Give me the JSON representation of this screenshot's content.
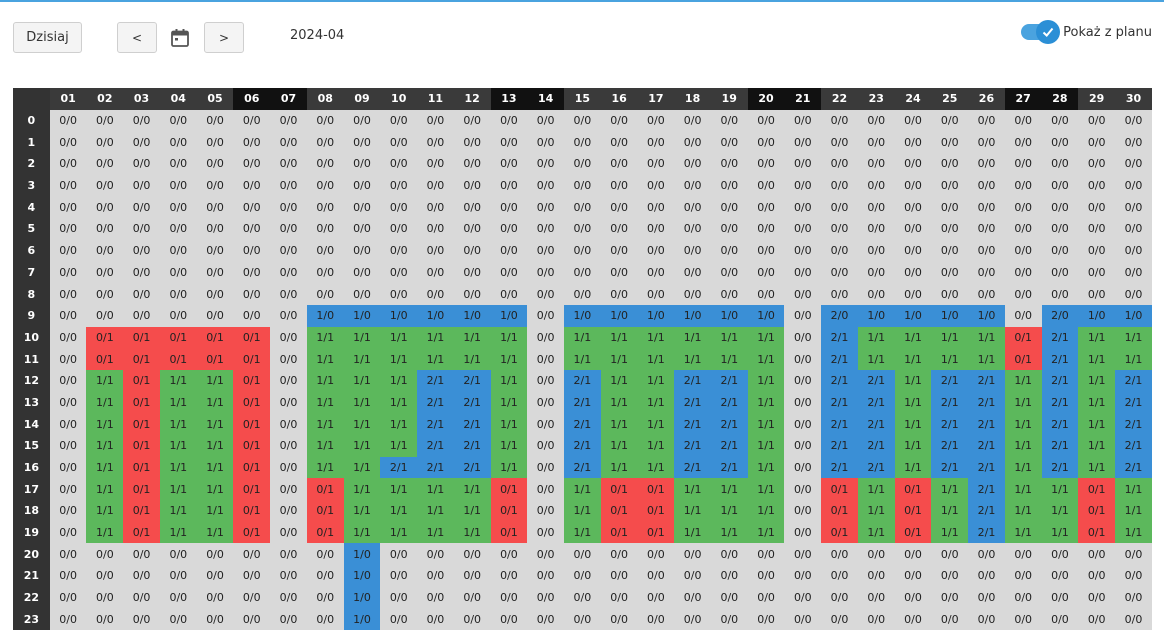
{
  "toolbar": {
    "today_label": "Dzisiaj",
    "prev_label": "<",
    "next_label": ">",
    "calendar_icon": "calendar-icon",
    "period": "2024-04",
    "toggle_label": "Pokaż z planu",
    "toggle_on": true
  },
  "colors": {
    "empty": "#d9d9d9",
    "red": "#f54c4c",
    "green": "#5cb85c",
    "blue": "#3a8fd6",
    "header": "#3a3a3a",
    "weekend_header": "#111111",
    "accent": "#4aa3df"
  },
  "grid": {
    "days": [
      "01",
      "02",
      "03",
      "04",
      "05",
      "06",
      "07",
      "08",
      "09",
      "10",
      "11",
      "12",
      "13",
      "14",
      "15",
      "16",
      "17",
      "18",
      "19",
      "20",
      "21",
      "22",
      "23",
      "24",
      "25",
      "26",
      "27",
      "28",
      "29",
      "30"
    ],
    "weekend_days": [
      "06",
      "07",
      "13",
      "14",
      "20",
      "21",
      "27",
      "28"
    ],
    "hours": [
      "0",
      "1",
      "2",
      "3",
      "4",
      "5",
      "6",
      "7",
      "8",
      "9",
      "10",
      "11",
      "12",
      "13",
      "14",
      "15",
      "16",
      "17",
      "18",
      "19",
      "20",
      "21",
      "22",
      "23"
    ],
    "rows": [
      [
        "0/0",
        "0/0",
        "0/0",
        "0/0",
        "0/0",
        "0/0",
        "0/0",
        "0/0",
        "0/0",
        "0/0",
        "0/0",
        "0/0",
        "0/0",
        "0/0",
        "0/0",
        "0/0",
        "0/0",
        "0/0",
        "0/0",
        "0/0",
        "0/0",
        "0/0",
        "0/0",
        "0/0",
        "0/0",
        "0/0",
        "0/0",
        "0/0",
        "0/0",
        "0/0"
      ],
      [
        "0/0",
        "0/0",
        "0/0",
        "0/0",
        "0/0",
        "0/0",
        "0/0",
        "0/0",
        "0/0",
        "0/0",
        "0/0",
        "0/0",
        "0/0",
        "0/0",
        "0/0",
        "0/0",
        "0/0",
        "0/0",
        "0/0",
        "0/0",
        "0/0",
        "0/0",
        "0/0",
        "0/0",
        "0/0",
        "0/0",
        "0/0",
        "0/0",
        "0/0",
        "0/0"
      ],
      [
        "0/0",
        "0/0",
        "0/0",
        "0/0",
        "0/0",
        "0/0",
        "0/0",
        "0/0",
        "0/0",
        "0/0",
        "0/0",
        "0/0",
        "0/0",
        "0/0",
        "0/0",
        "0/0",
        "0/0",
        "0/0",
        "0/0",
        "0/0",
        "0/0",
        "0/0",
        "0/0",
        "0/0",
        "0/0",
        "0/0",
        "0/0",
        "0/0",
        "0/0",
        "0/0"
      ],
      [
        "0/0",
        "0/0",
        "0/0",
        "0/0",
        "0/0",
        "0/0",
        "0/0",
        "0/0",
        "0/0",
        "0/0",
        "0/0",
        "0/0",
        "0/0",
        "0/0",
        "0/0",
        "0/0",
        "0/0",
        "0/0",
        "0/0",
        "0/0",
        "0/0",
        "0/0",
        "0/0",
        "0/0",
        "0/0",
        "0/0",
        "0/0",
        "0/0",
        "0/0",
        "0/0"
      ],
      [
        "0/0",
        "0/0",
        "0/0",
        "0/0",
        "0/0",
        "0/0",
        "0/0",
        "0/0",
        "0/0",
        "0/0",
        "0/0",
        "0/0",
        "0/0",
        "0/0",
        "0/0",
        "0/0",
        "0/0",
        "0/0",
        "0/0",
        "0/0",
        "0/0",
        "0/0",
        "0/0",
        "0/0",
        "0/0",
        "0/0",
        "0/0",
        "0/0",
        "0/0",
        "0/0"
      ],
      [
        "0/0",
        "0/0",
        "0/0",
        "0/0",
        "0/0",
        "0/0",
        "0/0",
        "0/0",
        "0/0",
        "0/0",
        "0/0",
        "0/0",
        "0/0",
        "0/0",
        "0/0",
        "0/0",
        "0/0",
        "0/0",
        "0/0",
        "0/0",
        "0/0",
        "0/0",
        "0/0",
        "0/0",
        "0/0",
        "0/0",
        "0/0",
        "0/0",
        "0/0",
        "0/0"
      ],
      [
        "0/0",
        "0/0",
        "0/0",
        "0/0",
        "0/0",
        "0/0",
        "0/0",
        "0/0",
        "0/0",
        "0/0",
        "0/0",
        "0/0",
        "0/0",
        "0/0",
        "0/0",
        "0/0",
        "0/0",
        "0/0",
        "0/0",
        "0/0",
        "0/0",
        "0/0",
        "0/0",
        "0/0",
        "0/0",
        "0/0",
        "0/0",
        "0/0",
        "0/0",
        "0/0"
      ],
      [
        "0/0",
        "0/0",
        "0/0",
        "0/0",
        "0/0",
        "0/0",
        "0/0",
        "0/0",
        "0/0",
        "0/0",
        "0/0",
        "0/0",
        "0/0",
        "0/0",
        "0/0",
        "0/0",
        "0/0",
        "0/0",
        "0/0",
        "0/0",
        "0/0",
        "0/0",
        "0/0",
        "0/0",
        "0/0",
        "0/0",
        "0/0",
        "0/0",
        "0/0",
        "0/0"
      ],
      [
        "0/0",
        "0/0",
        "0/0",
        "0/0",
        "0/0",
        "0/0",
        "0/0",
        "0/0",
        "0/0",
        "0/0",
        "0/0",
        "0/0",
        "0/0",
        "0/0",
        "0/0",
        "0/0",
        "0/0",
        "0/0",
        "0/0",
        "0/0",
        "0/0",
        "0/0",
        "0/0",
        "0/0",
        "0/0",
        "0/0",
        "0/0",
        "0/0",
        "0/0",
        "0/0"
      ],
      [
        "0/0",
        "0/0",
        "0/0",
        "0/0",
        "0/0",
        "0/0",
        "0/0",
        "1/0",
        "1/0",
        "1/0",
        "1/0",
        "1/0",
        "1/0",
        "0/0",
        "1/0",
        "1/0",
        "1/0",
        "1/0",
        "1/0",
        "1/0",
        "0/0",
        "2/0",
        "1/0",
        "1/0",
        "1/0",
        "1/0",
        "0/0",
        "2/0",
        "1/0",
        "1/0"
      ],
      [
        "0/0",
        "0/1",
        "0/1",
        "0/1",
        "0/1",
        "0/1",
        "0/0",
        "1/1",
        "1/1",
        "1/1",
        "1/1",
        "1/1",
        "1/1",
        "0/0",
        "1/1",
        "1/1",
        "1/1",
        "1/1",
        "1/1",
        "1/1",
        "0/0",
        "2/1",
        "1/1",
        "1/1",
        "1/1",
        "1/1",
        "0/1",
        "2/1",
        "1/1",
        "1/1"
      ],
      [
        "0/0",
        "0/1",
        "0/1",
        "0/1",
        "0/1",
        "0/1",
        "0/0",
        "1/1",
        "1/1",
        "1/1",
        "1/1",
        "1/1",
        "1/1",
        "0/0",
        "1/1",
        "1/1",
        "1/1",
        "1/1",
        "1/1",
        "1/1",
        "0/0",
        "2/1",
        "1/1",
        "1/1",
        "1/1",
        "1/1",
        "0/1",
        "2/1",
        "1/1",
        "1/1"
      ],
      [
        "0/0",
        "1/1",
        "0/1",
        "1/1",
        "1/1",
        "0/1",
        "0/0",
        "1/1",
        "1/1",
        "1/1",
        "2/1",
        "2/1",
        "1/1",
        "0/0",
        "2/1",
        "1/1",
        "1/1",
        "2/1",
        "2/1",
        "1/1",
        "0/0",
        "2/1",
        "2/1",
        "1/1",
        "2/1",
        "2/1",
        "1/1",
        "2/1",
        "1/1",
        "2/1"
      ],
      [
        "0/0",
        "1/1",
        "0/1",
        "1/1",
        "1/1",
        "0/1",
        "0/0",
        "1/1",
        "1/1",
        "1/1",
        "2/1",
        "2/1",
        "1/1",
        "0/0",
        "2/1",
        "1/1",
        "1/1",
        "2/1",
        "2/1",
        "1/1",
        "0/0",
        "2/1",
        "2/1",
        "1/1",
        "2/1",
        "2/1",
        "1/1",
        "2/1",
        "1/1",
        "2/1"
      ],
      [
        "0/0",
        "1/1",
        "0/1",
        "1/1",
        "1/1",
        "0/1",
        "0/0",
        "1/1",
        "1/1",
        "1/1",
        "2/1",
        "2/1",
        "1/1",
        "0/0",
        "2/1",
        "1/1",
        "1/1",
        "2/1",
        "2/1",
        "1/1",
        "0/0",
        "2/1",
        "2/1",
        "1/1",
        "2/1",
        "2/1",
        "1/1",
        "2/1",
        "1/1",
        "2/1"
      ],
      [
        "0/0",
        "1/1",
        "0/1",
        "1/1",
        "1/1",
        "0/1",
        "0/0",
        "1/1",
        "1/1",
        "1/1",
        "2/1",
        "2/1",
        "1/1",
        "0/0",
        "2/1",
        "1/1",
        "1/1",
        "2/1",
        "2/1",
        "1/1",
        "0/0",
        "2/1",
        "2/1",
        "1/1",
        "2/1",
        "2/1",
        "1/1",
        "2/1",
        "1/1",
        "2/1"
      ],
      [
        "0/0",
        "1/1",
        "0/1",
        "1/1",
        "1/1",
        "0/1",
        "0/0",
        "1/1",
        "1/1",
        "2/1",
        "2/1",
        "2/1",
        "1/1",
        "0/0",
        "2/1",
        "1/1",
        "1/1",
        "2/1",
        "2/1",
        "1/1",
        "0/0",
        "2/1",
        "2/1",
        "1/1",
        "2/1",
        "2/1",
        "1/1",
        "2/1",
        "1/1",
        "2/1"
      ],
      [
        "0/0",
        "1/1",
        "0/1",
        "1/1",
        "1/1",
        "0/1",
        "0/0",
        "0/1",
        "1/1",
        "1/1",
        "1/1",
        "1/1",
        "0/1",
        "0/0",
        "1/1",
        "0/1",
        "0/1",
        "1/1",
        "1/1",
        "1/1",
        "0/0",
        "0/1",
        "1/1",
        "0/1",
        "1/1",
        "2/1",
        "1/1",
        "1/1",
        "0/1",
        "1/1"
      ],
      [
        "0/0",
        "1/1",
        "0/1",
        "1/1",
        "1/1",
        "0/1",
        "0/0",
        "0/1",
        "1/1",
        "1/1",
        "1/1",
        "1/1",
        "0/1",
        "0/0",
        "1/1",
        "0/1",
        "0/1",
        "1/1",
        "1/1",
        "1/1",
        "0/0",
        "0/1",
        "1/1",
        "0/1",
        "1/1",
        "2/1",
        "1/1",
        "1/1",
        "0/1",
        "1/1"
      ],
      [
        "0/0",
        "1/1",
        "0/1",
        "1/1",
        "1/1",
        "0/1",
        "0/0",
        "0/1",
        "1/1",
        "1/1",
        "1/1",
        "1/1",
        "0/1",
        "0/0",
        "1/1",
        "0/1",
        "0/1",
        "1/1",
        "1/1",
        "1/1",
        "0/0",
        "0/1",
        "1/1",
        "0/1",
        "1/1",
        "2/1",
        "1/1",
        "1/1",
        "0/1",
        "1/1"
      ],
      [
        "0/0",
        "0/0",
        "0/0",
        "0/0",
        "0/0",
        "0/0",
        "0/0",
        "0/0",
        "1/0",
        "0/0",
        "0/0",
        "0/0",
        "0/0",
        "0/0",
        "0/0",
        "0/0",
        "0/0",
        "0/0",
        "0/0",
        "0/0",
        "0/0",
        "0/0",
        "0/0",
        "0/0",
        "0/0",
        "0/0",
        "0/0",
        "0/0",
        "0/0",
        "0/0"
      ],
      [
        "0/0",
        "0/0",
        "0/0",
        "0/0",
        "0/0",
        "0/0",
        "0/0",
        "0/0",
        "1/0",
        "0/0",
        "0/0",
        "0/0",
        "0/0",
        "0/0",
        "0/0",
        "0/0",
        "0/0",
        "0/0",
        "0/0",
        "0/0",
        "0/0",
        "0/0",
        "0/0",
        "0/0",
        "0/0",
        "0/0",
        "0/0",
        "0/0",
        "0/0",
        "0/0"
      ],
      [
        "0/0",
        "0/0",
        "0/0",
        "0/0",
        "0/0",
        "0/0",
        "0/0",
        "0/0",
        "1/0",
        "0/0",
        "0/0",
        "0/0",
        "0/0",
        "0/0",
        "0/0",
        "0/0",
        "0/0",
        "0/0",
        "0/0",
        "0/0",
        "0/0",
        "0/0",
        "0/0",
        "0/0",
        "0/0",
        "0/0",
        "0/0",
        "0/0",
        "0/0",
        "0/0"
      ],
      [
        "0/0",
        "0/0",
        "0/0",
        "0/0",
        "0/0",
        "0/0",
        "0/0",
        "0/0",
        "1/0",
        "0/0",
        "0/0",
        "0/0",
        "0/0",
        "0/0",
        "0/0",
        "0/0",
        "0/0",
        "0/0",
        "0/0",
        "0/0",
        "0/0",
        "0/0",
        "0/0",
        "0/0",
        "0/0",
        "0/0",
        "0/0",
        "0/0",
        "0/0",
        "0/0"
      ]
    ]
  }
}
